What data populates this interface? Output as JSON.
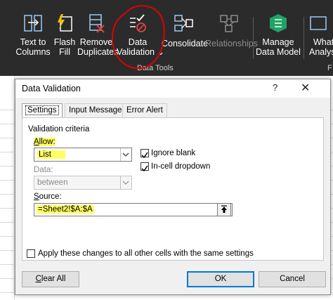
{
  "ribbon": {
    "buttons": [
      {
        "line1": "Text to",
        "line2": "Columns",
        "icon": "text-to-columns-icon"
      },
      {
        "line1": "Flash",
        "line2": "Fill",
        "icon": "flash-fill-icon"
      },
      {
        "line1": "Remove",
        "line2": "Duplicates",
        "icon": "remove-duplicates-icon"
      },
      {
        "line1": "Data",
        "line2": "Validation ⌄",
        "icon": "data-validation-icon"
      },
      {
        "line1": "Consolidate",
        "line2": "",
        "icon": "consolidate-icon"
      },
      {
        "line1": "Relationships",
        "line2": "",
        "icon": "relationships-icon"
      },
      {
        "line1": "Manage",
        "line2": "Data Model",
        "icon": "data-model-icon"
      },
      {
        "line1": "What-",
        "line2": "Analysis",
        "icon": "what-if-icon"
      }
    ],
    "group_label": "Data Tools",
    "next_group_label": "F",
    "colors": {
      "background": "#2b2b2b",
      "annotation_circle": "#e00000",
      "data_model_green": "#21a366"
    }
  },
  "dialog": {
    "title": "Data Validation",
    "help": "?",
    "close": "✕",
    "tabs": [
      "Settings",
      "Input Message",
      "Error Alert"
    ],
    "section_title": "Validation criteria",
    "allow_label": "Allow:",
    "allow_value": "List",
    "data_label": "Data:",
    "data_value": "between",
    "ignore_blank_label": "Ignore blank",
    "ignore_blank_checked": true,
    "in_cell_dropdown_label": "In-cell dropdown",
    "in_cell_dropdown_checked": true,
    "source_label": "Source:",
    "source_value": "=Sheet2!$A:$A",
    "apply_all_label": "Apply these changes to all other cells with the same settings",
    "apply_all_checked": false,
    "buttons": {
      "clear_all": "Clear All",
      "ok": "OK",
      "cancel": "Cancel"
    },
    "highlight_color": "#ffff66"
  }
}
